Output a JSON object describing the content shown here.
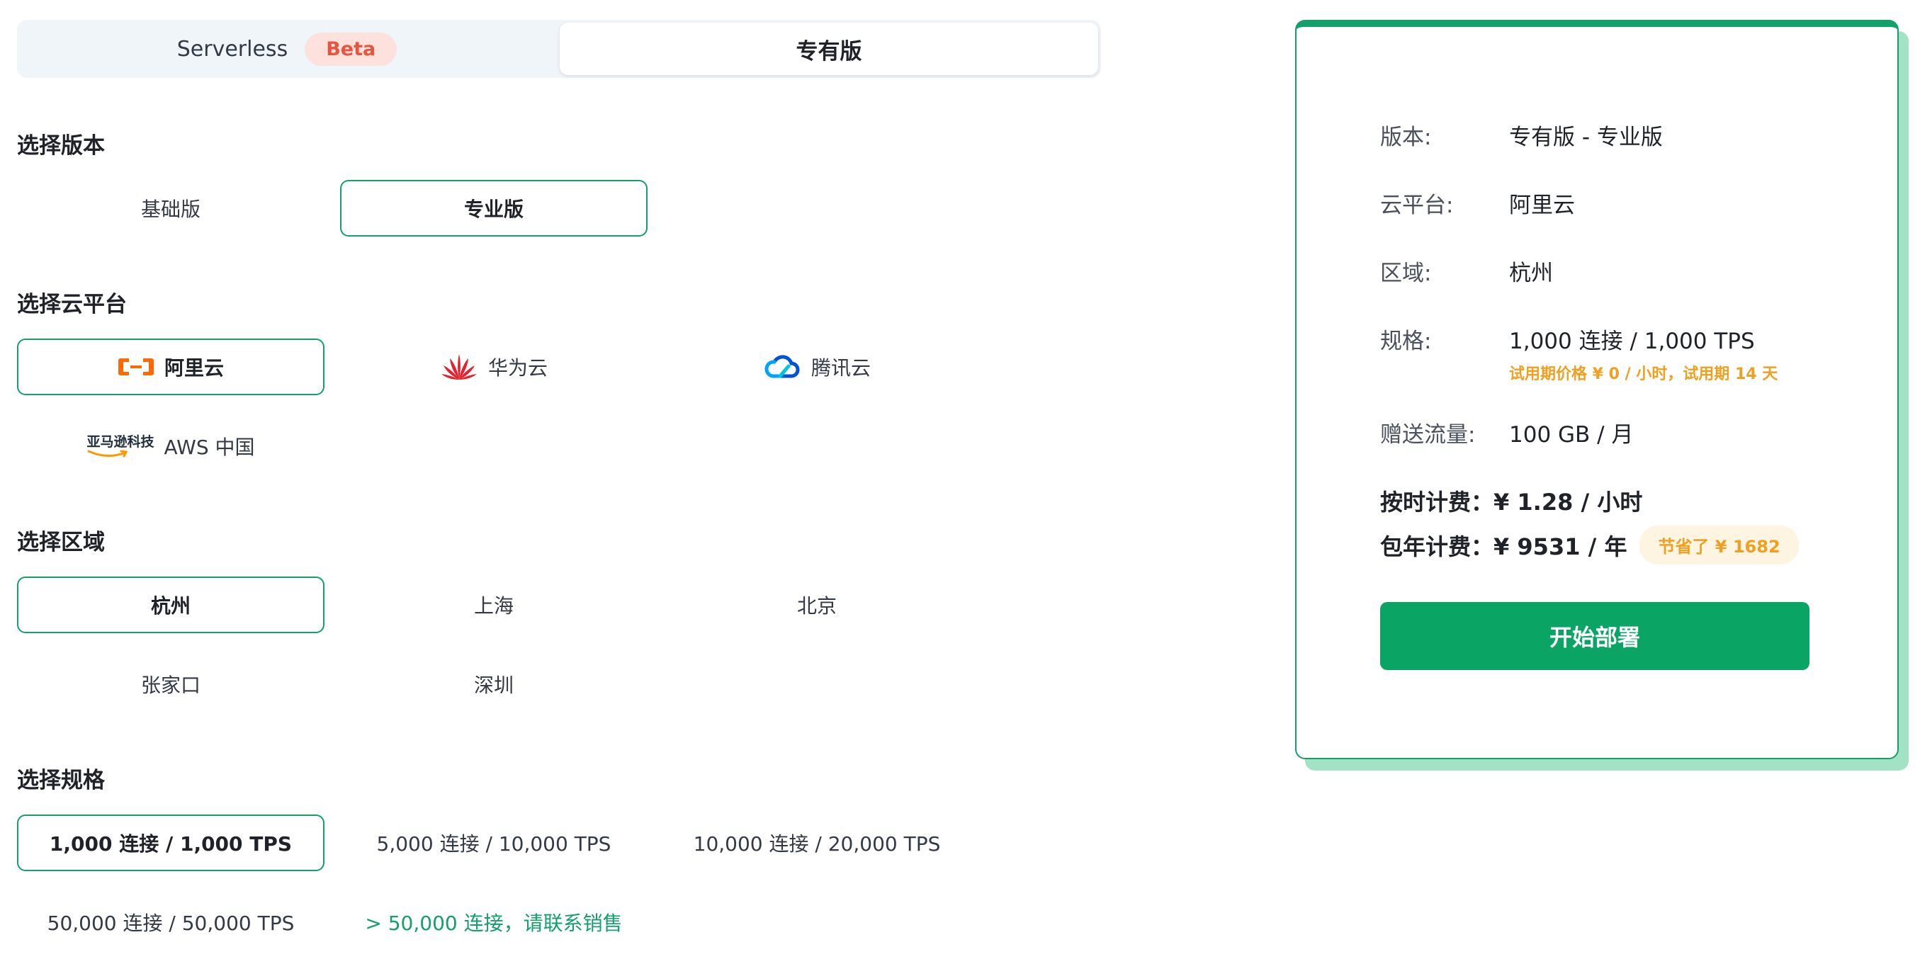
{
  "mode_switch": {
    "serverless_label": "Serverless",
    "beta_label": "Beta",
    "dedicated_label": "专有版"
  },
  "sections": {
    "edition_title": "选择版本",
    "cloud_title": "选择云平台",
    "region_title": "选择区域",
    "spec_title": "选择规格"
  },
  "editions": [
    {
      "label": "基础版",
      "selected": false
    },
    {
      "label": "专业版",
      "selected": true
    }
  ],
  "clouds": [
    {
      "label": "阿里云",
      "icon": "aliyun-logo-icon",
      "selected": true
    },
    {
      "label": "华为云",
      "icon": "huawei-logo-icon",
      "selected": false
    },
    {
      "label": "腾讯云",
      "icon": "tencent-cloud-logo-icon",
      "selected": false
    },
    {
      "label": "AWS 中国",
      "logo_text": "亚马逊科技",
      "icon": "amazon-logo-icon",
      "selected": false
    }
  ],
  "regions": [
    {
      "label": "杭州",
      "selected": true
    },
    {
      "label": "上海",
      "selected": false
    },
    {
      "label": "北京",
      "selected": false
    },
    {
      "label": "张家口",
      "selected": false
    },
    {
      "label": "深圳",
      "selected": false
    }
  ],
  "specs": [
    {
      "label": "1,000 连接 / 1,000 TPS",
      "selected": true
    },
    {
      "label": "5,000 连接 / 10,000 TPS",
      "selected": false
    },
    {
      "label": "10,000 连接 / 20,000 TPS",
      "selected": false
    },
    {
      "label": "50,000 连接 / 50,000 TPS",
      "selected": false
    },
    {
      "label": "> 50,000 连接，请联系销售",
      "selected": false
    }
  ],
  "summary": {
    "edition_key": "版本:",
    "edition_value": "专有版 - 专业版",
    "cloud_key": "云平台:",
    "cloud_value": "阿里云",
    "region_key": "区域:",
    "region_value": "杭州",
    "spec_key": "规格:",
    "spec_value": "1,000 连接 / 1,000 TPS",
    "trial_note": "试用期价格 ¥ 0 / 小时，试用期 14 天",
    "traffic_key": "赠送流量:",
    "traffic_value": "100 GB / 月",
    "hourly_price": "按时计费：¥ 1.28 / 小时",
    "yearly_price": "包年计费：¥ 9531 / 年",
    "savings_badge": "节省了 ¥ 1682",
    "deploy_button": "开始部署"
  },
  "colors": {
    "accent_green": "#13a06a",
    "button_green": "#0aa565",
    "shadow_green": "#a3e2c4",
    "beta_bg": "#fde1dd",
    "beta_text": "#e8553e",
    "trial_orange": "#f0a020",
    "badge_bg": "#fef4e2",
    "switch_bg": "#f0f5fa"
  }
}
